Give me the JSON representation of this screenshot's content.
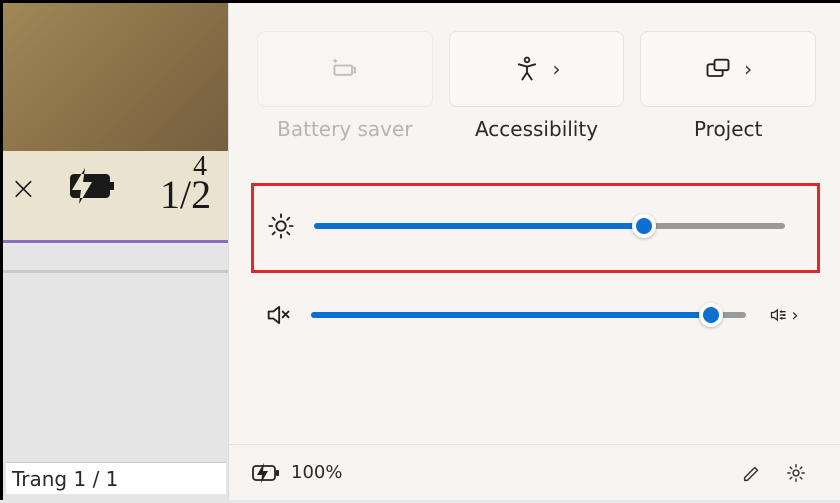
{
  "background": {
    "fraction_numerator": "4",
    "fraction_main": "1/2",
    "page_status": "Trang 1 / 1"
  },
  "tiles": {
    "battery_saver": {
      "label": "Battery saver"
    },
    "accessibility": {
      "label": "Accessibility"
    },
    "project": {
      "label": "Project"
    }
  },
  "sliders": {
    "brightness_percent": 70,
    "volume_percent": 92
  },
  "bottom": {
    "battery_level": "100%"
  },
  "colors": {
    "accent": "#0c6fd1",
    "highlight": "#e22828"
  }
}
